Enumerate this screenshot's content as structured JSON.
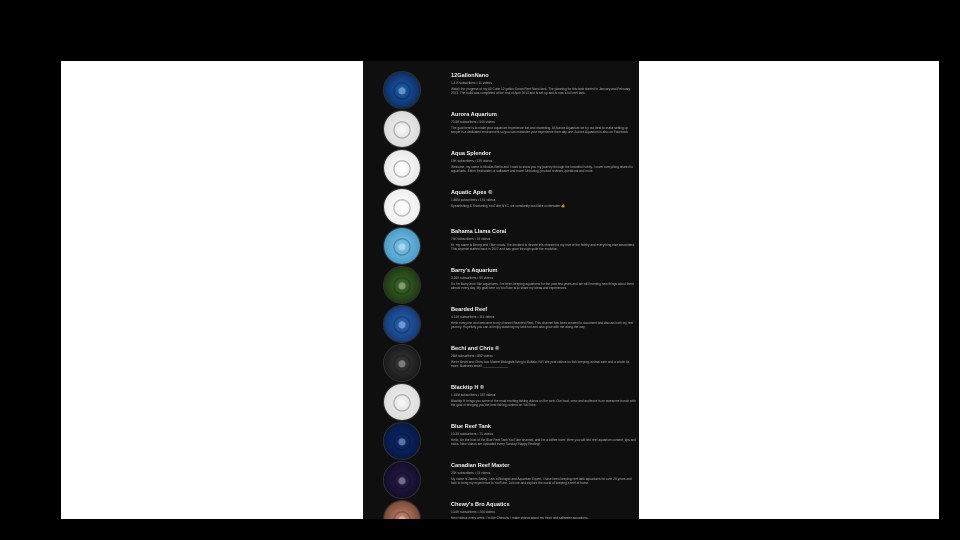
{
  "channels": [
    {
      "name": "12GallonNano",
      "meta": "1.4 K subscribers • 11 videos",
      "desc": "Watch the progress of my 60 Cube 12 gallon Oman Reef Nano tank. The planning for this tank started in January and February 2013. The build was completed at the end of April 2013 and is set up and is now a full reef tank.",
      "avatar_colors": [
        "#1d5fb0",
        "#0b2f66"
      ],
      "avatar_icon": "12-gallon-nano-logo-icon"
    },
    {
      "name": "Aurora Aquarium",
      "meta": "70.8K subscribers • 540 videos",
      "desc": "The goal here is to make your aquarium experience fun and rewarding. At Aurora Aquarium we try our best to make setting up simple in a dedicated environment so you can maximize your experience from day one. Aurora Aquarium is also on Facebook where you will find",
      "avatar_colors": [
        "#f4f4f4",
        "#d9d9d9"
      ],
      "avatar_icon": "aurora-fish-logo-icon"
    },
    {
      "name": "Aqua Splendor",
      "meta": "19K subscribers • 139 videos",
      "desc": "Welcome, my name is Nicolas Berlin and I want to show you my journey through the beautiful hobby. I cover everything related to aquariums. Either freshwater or saltwater and more! Unboxing, product reviews, questions and more.",
      "avatar_colors": [
        "#ffffff",
        "#e8e8e8"
      ],
      "avatar_icon": "coral-logo-icon"
    },
    {
      "name": "Aquatic Apes ®",
      "meta": "1.86M subscribers • 191 videos",
      "desc": "Spearfishing & Snorkeling YouTube NYC, we constantly bust fake underwater 🐠",
      "avatar_colors": [
        "#ffffff",
        "#eeeeee"
      ],
      "avatar_icon": "diver-logo-icon"
    },
    {
      "name": "Bahama Llama Coral",
      "meta": "74K subscribers • 15 videos",
      "desc": "Hi, my name is Benny and I like corals. I've decided to devote this channel to my love of the hobby and everything else associated. This channel started back in 2007 and has gone through quite the evolution.",
      "avatar_colors": [
        "#7ec3e6",
        "#4a9bc8"
      ],
      "avatar_icon": "llama-cartoon-icon"
    },
    {
      "name": "Barry's Aquarium",
      "meta": "3.26K subscribers • 90 videos",
      "desc": "So I'm Barry and I like aquariums. I've been keeping aquariums for the past few years and am still learning new things about them almost every day. My goal here on YouTube is to share my ideas and experiences.",
      "avatar_colors": [
        "#3f6a2a",
        "#1e3b14"
      ],
      "avatar_icon": "planted-tank-icon"
    },
    {
      "name": "Bearded Reef",
      "meta": "4.14K subscribers • 111 videos",
      "desc": "Hello everyone and welcome to my channel Bearded Reef. This channel has been created to document and discuss both my reef journey. Hopefully you can all enjoy watching my tank too and also grow with me along the way.",
      "avatar_colors": [
        "#2a64b4",
        "#153c7a"
      ],
      "avatar_icon": "bearded-reef-logo-icon"
    },
    {
      "name": "Bechi and Chris ®",
      "meta": "26M subscribers • 892 videos",
      "desc": "We're Bechi and Chris, two Marine Biologists living in Buffalo, NY! We post videos on fish keeping, animal care and a whole lot more. Business email: ______________",
      "avatar_colors": [
        "#3a3a3a",
        "#1a1a1a"
      ],
      "avatar_icon": "couple-photo-icon"
    },
    {
      "name": "Blacktip H ®",
      "meta": "1.15M subscribers • 387 videos",
      "desc": "Blacktip H brings you some of the most exciting fishing videos on the web. Our boat, crew and audience is an awesome bunch with the goal of bringing you the best fishing content on YouTube.",
      "avatar_colors": [
        "#f2f2f2",
        "#dcdcdc"
      ],
      "avatar_icon": "blacktip-logo-icon"
    },
    {
      "name": "Blue Reef Tank",
      "meta": "10.3K subscribers • 71 videos",
      "desc": "Hello, I'm the host of the Blue Reef Tank YouTube channel, and I'm a coffee lover. Here you will find reef aquarium content, tips and tricks. New videos are uploaded every Sunday. Happy Reefing!",
      "avatar_colors": [
        "#0d2a6e",
        "#061845"
      ],
      "avatar_icon": "blue-reef-tank-logo-icon"
    },
    {
      "name": "Canadian Reef Master",
      "meta": "23K subscribers • 74 videos",
      "desc": "My name is James Bailey. I am a Biologist and Aquarium Expert. I have been keeping reef tank aquariums for over 25 years and look to bring my experience to YouTube. Join me and explore the world of keeping a reef at home.",
      "avatar_colors": [
        "#2a1f4a",
        "#130d2a"
      ],
      "avatar_icon": "host-photo-icon"
    },
    {
      "name": "Chewy's Bro Aquatics",
      "meta": "13.6K subscribers • 246 videos",
      "desc": "New videos every week, I'm the Chewy's! I make videos about my fresh and saltwater aquariums.",
      "avatar_colors": [
        "#c98a6e",
        "#7a4a38"
      ],
      "avatar_icon": "host-face-photo-icon"
    }
  ]
}
